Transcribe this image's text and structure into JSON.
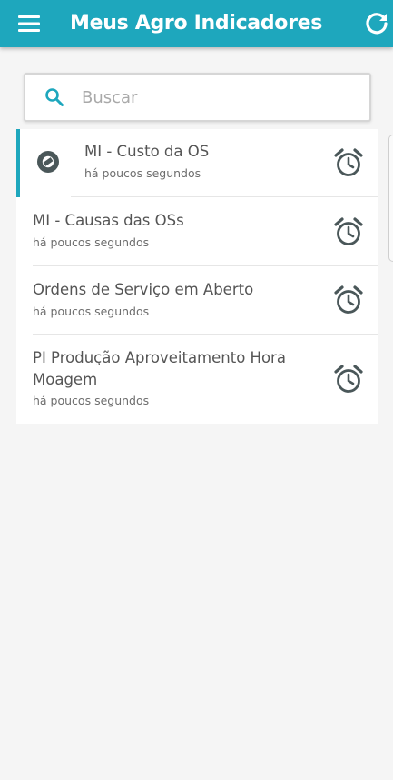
{
  "header": {
    "title": "Meus Agro Indicadores",
    "menu_icon": "menu-icon",
    "refresh_icon": "refresh-icon",
    "bg_color": "#1ea7bd"
  },
  "search": {
    "placeholder": "Buscar",
    "value": "",
    "icon": "search-icon"
  },
  "list": {
    "items": [
      {
        "title": "MI - Custo da OS",
        "subtitle": "há poucos segundos",
        "selected": true,
        "icon": "alarm-clock-icon"
      },
      {
        "title": "MI - Causas das OSs",
        "subtitle": "há poucos segundos",
        "selected": false,
        "icon": "alarm-clock-icon"
      },
      {
        "title": "Ordens de Serviço em Aberto",
        "subtitle": "há poucos segundos",
        "selected": false,
        "icon": "alarm-clock-icon"
      },
      {
        "title_line1": "PI Produção Aproveitamento Hora",
        "title_line2": "Moagem",
        "subtitle": "há poucos segundos",
        "selected": false,
        "icon": "alarm-clock-icon"
      }
    ]
  },
  "colors": {
    "accent": "#1ea7bd",
    "icon_dark": "#4a5759"
  }
}
